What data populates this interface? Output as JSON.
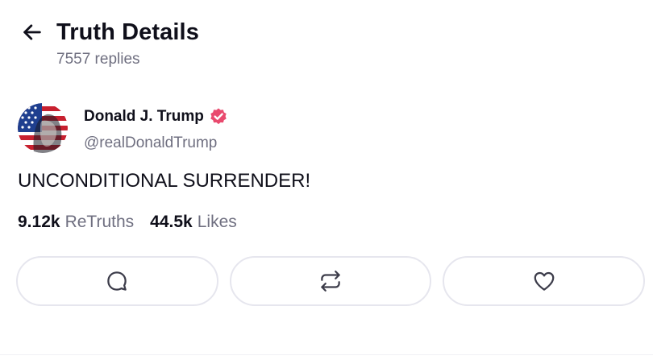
{
  "header": {
    "title": "Truth Details",
    "replies": "7557 replies",
    "back_icon": "arrow-left-icon"
  },
  "post": {
    "author_name": "Donald J. Trump",
    "author_handle": "@realDonaldTrump",
    "verified_icon": "verified-badge-icon",
    "verified_color": "#e94a6e",
    "text": "UNCONDITIONAL SURRENDER!",
    "stats": {
      "retruths_count": "9.12k",
      "retruths_label": "ReTruths",
      "likes_count": "44.5k",
      "likes_label": "Likes"
    }
  },
  "actions": {
    "reply_icon": "reply-bubble-icon",
    "retruth_icon": "retruth-arrows-icon",
    "like_icon": "heart-icon"
  },
  "colors": {
    "text_primary": "#0f0f1a",
    "text_secondary": "#6f6f80",
    "button_border": "#e6e6ee"
  }
}
